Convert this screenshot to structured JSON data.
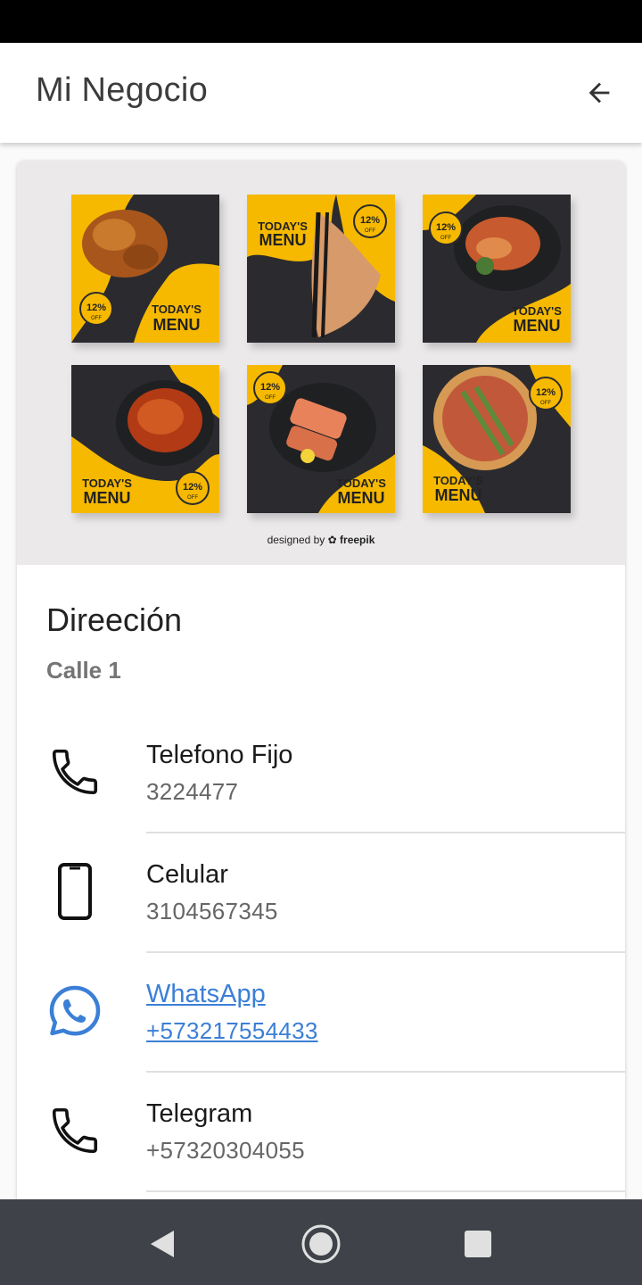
{
  "app_bar": {
    "title": "Mi Negocio",
    "back_icon": "arrow-back-icon"
  },
  "banner": {
    "tiles": [
      {
        "heading": "TODAY'S",
        "subheading": "MENU",
        "badge": "12%",
        "badge_sub": "OFF"
      },
      {
        "heading": "TODAY'S",
        "subheading": "MENU",
        "badge": "12%",
        "badge_sub": "OFF"
      },
      {
        "heading": "TODAY'S",
        "subheading": "MENU",
        "badge": "12%",
        "badge_sub": "OFF"
      },
      {
        "heading": "TODAY'S",
        "subheading": "MENU",
        "badge": "12%",
        "badge_sub": "OFF"
      },
      {
        "heading": "TODAY'S",
        "subheading": "MENU",
        "badge": "12%",
        "badge_sub": "OFF"
      },
      {
        "heading": "TODAY'S",
        "subheading": "MENU",
        "badge": "12%",
        "badge_sub": "OFF"
      }
    ],
    "credit_prefix": "designed by",
    "credit_brand": "freepik"
  },
  "address": {
    "title": "Direeción",
    "value": "Calle 1"
  },
  "contacts": [
    {
      "icon": "phone-icon",
      "title": "Telefono Fijo",
      "value": "3224477",
      "link": false
    },
    {
      "icon": "smartphone-icon",
      "title": "Celular",
      "value": "3104567345",
      "link": false
    },
    {
      "icon": "whatsapp-icon",
      "title": "WhatsApp",
      "value": "+573217554433",
      "link": true
    },
    {
      "icon": "phone-icon",
      "title": "Telegram",
      "value": "+57320304055",
      "link": false
    }
  ],
  "colors": {
    "accent_yellow": "#f6b900",
    "tile_dark": "#2b2b2f",
    "link_blue": "#3b7fd6",
    "whatsapp_blue": "#3b7fd6",
    "nav_bar": "#3f4349"
  },
  "nav": {
    "back": "triangle-back-icon",
    "home": "circle-home-icon",
    "recents": "square-recents-icon"
  }
}
